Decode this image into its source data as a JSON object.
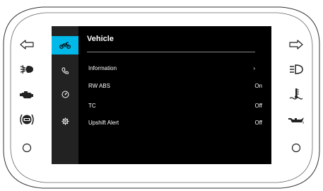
{
  "screen": {
    "title": "Vehicle",
    "colors": {
      "background": "#000000",
      "sidebar": "#222222",
      "accent": "#00b9e8",
      "text": "#ffffff",
      "rule": "#8a8a8a"
    }
  },
  "sidebar": {
    "items": [
      {
        "icon": "motorcycle-icon",
        "active": true
      },
      {
        "icon": "phone-icon",
        "active": false
      },
      {
        "icon": "gauge-icon",
        "active": false
      },
      {
        "icon": "gear-icon",
        "active": false
      }
    ]
  },
  "menu": {
    "items": [
      {
        "label": "Information",
        "value": "›"
      },
      {
        "label": "RW ABS",
        "value": "On"
      },
      {
        "label": "TC",
        "value": "Off"
      },
      {
        "label": "Upshift Alert",
        "value": "Off"
      }
    ]
  },
  "indicators": {
    "left": [
      "turn-left-icon",
      "fog-light-icon",
      "engine-check-icon",
      "brake-warning-icon",
      "circle-button-icon"
    ],
    "right": [
      "turn-right-icon",
      "high-beam-icon",
      "coolant-temp-icon",
      "oil-pressure-icon",
      "circle-button-icon"
    ]
  }
}
